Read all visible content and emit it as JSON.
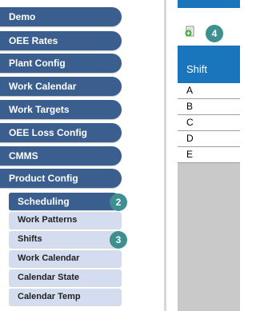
{
  "menu": {
    "items": [
      {
        "label": "Demo"
      },
      {
        "label": "OEE Rates"
      },
      {
        "label": "Plant Config"
      },
      {
        "label": "Work Calendar"
      },
      {
        "label": "Work Targets"
      },
      {
        "label": "OEE Loss Config"
      },
      {
        "label": "CMMS"
      },
      {
        "label": "Product Config"
      }
    ],
    "subitems": [
      {
        "label": "Scheduling",
        "active": true
      },
      {
        "label": "Work Patterns"
      },
      {
        "label": "Shifts"
      },
      {
        "label": "Work Calendar"
      },
      {
        "label": "Calendar State"
      },
      {
        "label": "Calendar Temp"
      }
    ]
  },
  "badges": {
    "scheduling": "2",
    "shifts": "3",
    "add": "4"
  },
  "grid": {
    "header": "Shift",
    "rows": [
      "A",
      "B",
      "C",
      "D",
      "E"
    ]
  },
  "colors": {
    "menu": "#3a5f8f",
    "submenu": "#d3ddef",
    "badge": "#3e8f8f",
    "grid_header": "#1b75bc"
  },
  "icons": {
    "add": "add-document-icon"
  }
}
